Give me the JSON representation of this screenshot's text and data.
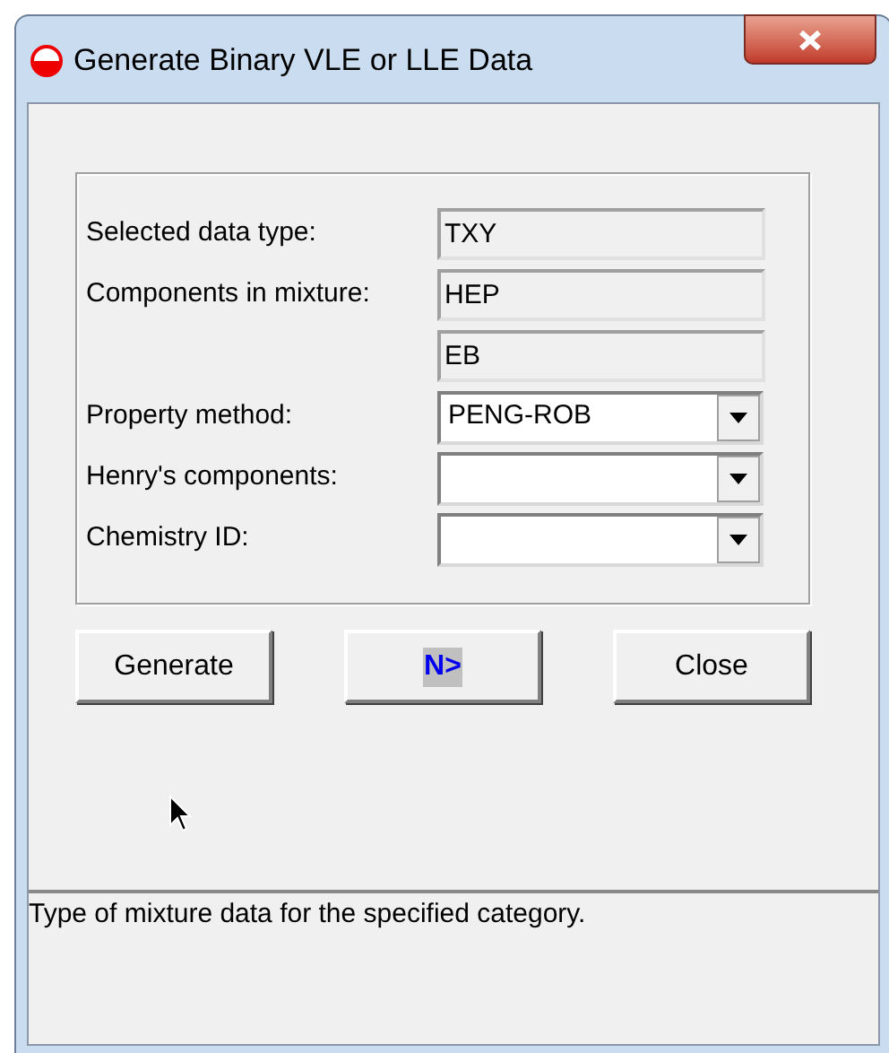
{
  "window": {
    "title": "Generate Binary VLE or LLE Data"
  },
  "fields": [
    {
      "label": "Selected data type:",
      "kind": "readonly",
      "value": "TXY"
    },
    {
      "label": "Components in mixture:",
      "kind": "readonly",
      "value": "HEP"
    },
    {
      "kind": "readonly",
      "value": "EB"
    },
    {
      "label": "Property method:",
      "kind": "combo",
      "value": "PENG-ROB"
    },
    {
      "label": "Henry's components:",
      "kind": "combo"
    },
    {
      "label": "Chemistry ID:",
      "kind": "combo"
    }
  ],
  "buttons": [
    {
      "label": "Generate",
      "kind": "text",
      "focused": false
    },
    {
      "label": "N>",
      "kind": "next",
      "focused": true
    },
    {
      "label": "Close",
      "kind": "text",
      "focused": false
    }
  ],
  "prompt": "Type of mixture data for the specified category."
}
